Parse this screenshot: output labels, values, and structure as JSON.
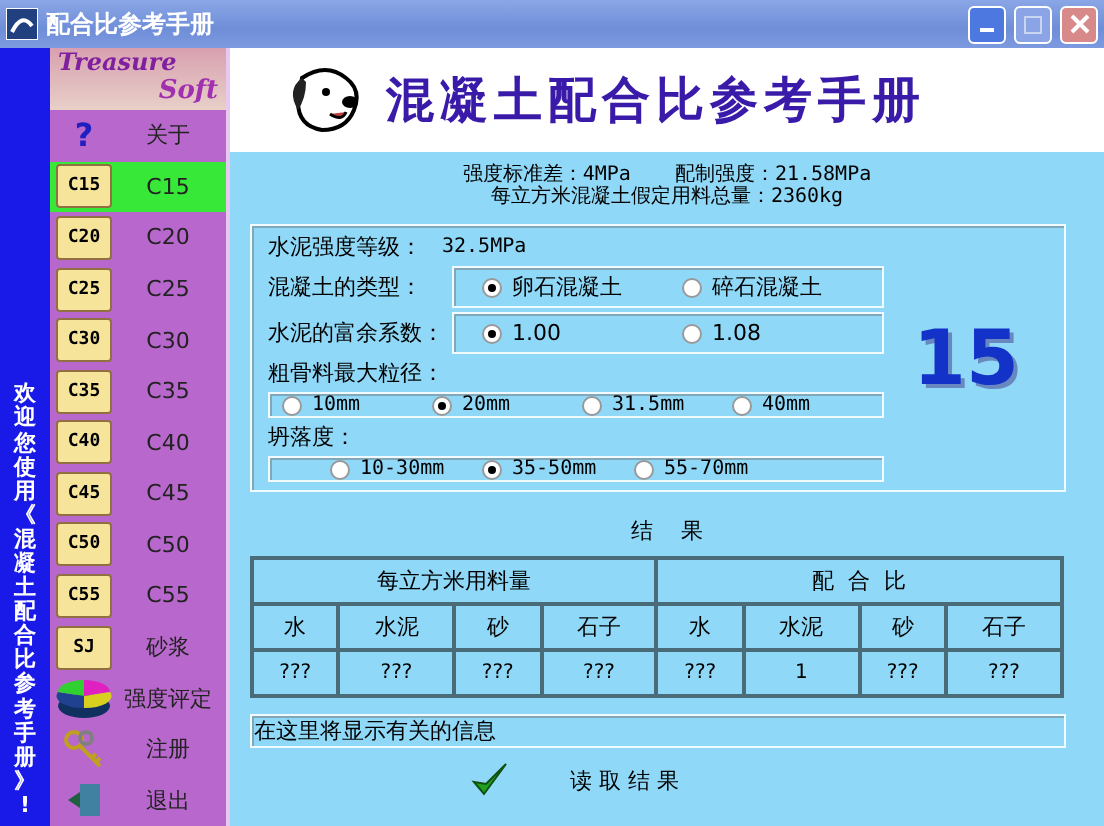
{
  "window": {
    "title": "配合比参考手册"
  },
  "welcome_banner": "欢迎您使用《混凝土配合比参考手册》!",
  "logo": {
    "line_1": "Treasure",
    "line_2": "Soft"
  },
  "sidebar": {
    "items": [
      {
        "kind": "help",
        "icon_text": "?",
        "label": "关于",
        "selected": false
      },
      {
        "kind": "folder",
        "icon_label": "C15",
        "label": "C15",
        "selected": true
      },
      {
        "kind": "folder",
        "icon_label": "C20",
        "label": "C20",
        "selected": false
      },
      {
        "kind": "folder",
        "icon_label": "C25",
        "label": "C25",
        "selected": false
      },
      {
        "kind": "folder",
        "icon_label": "C30",
        "label": "C30",
        "selected": false
      },
      {
        "kind": "folder",
        "icon_label": "C35",
        "label": "C35",
        "selected": false
      },
      {
        "kind": "folder",
        "icon_label": "C40",
        "label": "C40",
        "selected": false
      },
      {
        "kind": "folder",
        "icon_label": "C45",
        "label": "C45",
        "selected": false
      },
      {
        "kind": "folder",
        "icon_label": "C50",
        "label": "C50",
        "selected": false
      },
      {
        "kind": "folder",
        "icon_label": "C55",
        "label": "C55",
        "selected": false
      },
      {
        "kind": "folder",
        "icon_label": "SJ",
        "label": "砂浆",
        "selected": false
      },
      {
        "kind": "pie",
        "label": "强度评定",
        "selected": false
      },
      {
        "kind": "keys",
        "label": "注册",
        "selected": false
      },
      {
        "kind": "exit",
        "label": "退出",
        "selected": false
      }
    ]
  },
  "header": {
    "title": "混凝土配合比参考手册"
  },
  "info": {
    "std_dev": "强度标准差：4MPa",
    "design_strength": "配制强度：21.58MPa",
    "total_mass": "每立方米混凝土假定用料总量：2360kg"
  },
  "form": {
    "cement_grade": {
      "label": "水泥强度等级：",
      "value": "32.5MPa"
    },
    "options": [
      {
        "kind": "inline",
        "label": "混凝土的类型：",
        "choices": [
          {
            "label": "卵石混凝土",
            "selected": true
          },
          {
            "label": "碎石混凝土",
            "selected": false
          }
        ]
      },
      {
        "kind": "inline",
        "label": "水泥的富余系数：",
        "choices": [
          {
            "label": "1.00",
            "selected": true
          },
          {
            "label": "1.08",
            "selected": false
          }
        ]
      },
      {
        "kind": "stacked",
        "label": "粗骨料最大粒径：",
        "choices": [
          {
            "label": "10mm",
            "selected": false
          },
          {
            "label": "20mm",
            "selected": true
          },
          {
            "label": "31.5mm",
            "selected": false
          },
          {
            "label": "40mm",
            "selected": false
          }
        ]
      },
      {
        "kind": "stacked",
        "label": "坍落度：",
        "choices": [
          {
            "label": "10-30mm",
            "selected": false
          },
          {
            "label": "35-50mm",
            "selected": true
          },
          {
            "label": "55-70mm",
            "selected": false
          }
        ]
      }
    ],
    "grade_display": "15"
  },
  "results": {
    "title": "结    果",
    "groups": [
      "每立方米用料量",
      "配  合  比"
    ],
    "columns": [
      "水",
      "水泥",
      "砂",
      "石子",
      "水",
      "水泥",
      "砂",
      "石子"
    ],
    "values": [
      "???",
      "???",
      "???",
      "???",
      "???",
      "1",
      "???",
      "???"
    ]
  },
  "message": "在这里将显示有关的信息",
  "read_button": {
    "label": "读 取 结 果"
  }
}
